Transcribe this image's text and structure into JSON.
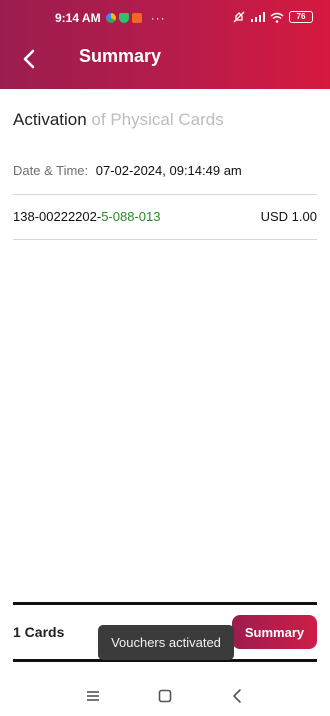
{
  "status_bar": {
    "time": "9:14 AM",
    "dots": "···",
    "battery": "76"
  },
  "header": {
    "title": "Summary",
    "back_icon": "chevron-left-icon"
  },
  "section": {
    "title_main": "Activation",
    "title_sub": " of Physical Cards"
  },
  "meta": {
    "datetime_label": "Date & Time:",
    "datetime_value": "07-02-2024, 09:14:49 am"
  },
  "card": {
    "number_prefix": "138-00222202-",
    "number_suffix": "5-088-013",
    "amount": "USD 1.00"
  },
  "footer": {
    "count_label": "1 Cards",
    "summary_button": "Summary"
  },
  "toast": {
    "message": "Vouchers activated"
  },
  "nav": {
    "menu_icon": "menu-icon",
    "home_icon": "square-home-icon",
    "back_icon": "triangle-back-icon"
  },
  "colors": {
    "brand_start": "#9b1d4f",
    "brand_end": "#d6193f",
    "card_suffix": "#2a8a2a"
  }
}
